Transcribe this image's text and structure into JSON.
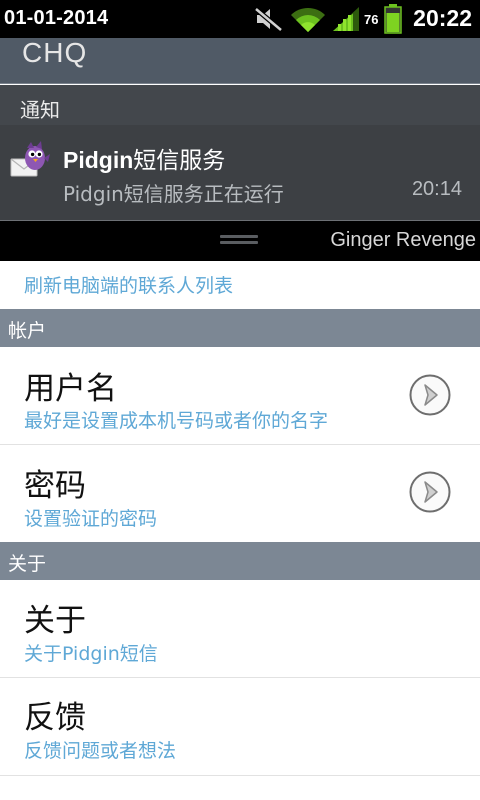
{
  "status_bar": {
    "date": "01-01-2014",
    "battery_level": "76",
    "time": "20:22",
    "icons": [
      "mute-icon",
      "wifi-icon",
      "signal-icon",
      "battery-icon"
    ]
  },
  "notification_shade": {
    "title": "CHQ",
    "section_label": "通知",
    "notification": {
      "app_icon": "pidgin-icon",
      "title_bold": "Pidgin",
      "title_rest": "短信服务",
      "text": "Pidgin短信服务正在运行",
      "time": "20:14"
    },
    "carrier": "Ginger Revenge"
  },
  "preferences": {
    "partial_item": {
      "summary": "刷新电脑端的联系人列表"
    },
    "sections": [
      {
        "header": "帐户",
        "items": [
          {
            "title": "用户名",
            "summary": "最好是设置成本机号码或者你的名字",
            "icon": "chevron-right-icon"
          },
          {
            "title": "密码",
            "summary": "设置验证的密码",
            "icon": "chevron-right-icon"
          }
        ]
      },
      {
        "header": "关于",
        "items": [
          {
            "title": "关于",
            "summary": "关于Pidgin短信"
          },
          {
            "title": "反馈",
            "summary": "反馈问题或者想法"
          }
        ]
      }
    ]
  },
  "colors": {
    "section_header": "#7c8794",
    "summary_text": "#5fa8d6",
    "shade_bg": "#3d4044"
  }
}
